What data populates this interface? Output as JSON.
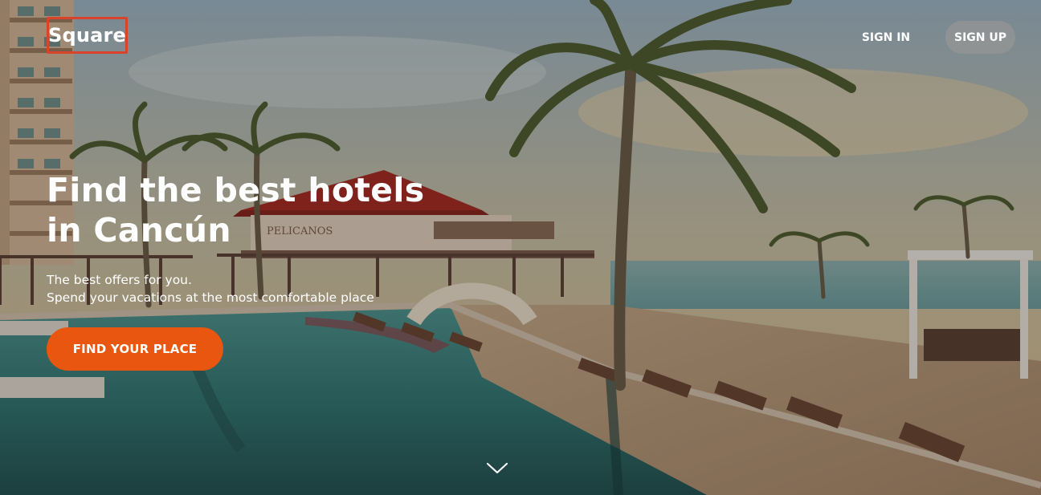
{
  "header": {
    "logo_text": "Square",
    "sign_in_label": "SIGN IN",
    "sign_up_label": "SIGN UP"
  },
  "hero": {
    "headline_lines": [
      "Find the best hotels",
      "in Cancún"
    ],
    "sub_lines": [
      "The best offers for you.",
      "Spend your vacations at the most comfortable place"
    ],
    "cta_label": "FIND YOUR PLACE",
    "sign_text": "PELICANOS",
    "scroll_icon": "chevron-down-icon"
  },
  "colors": {
    "accent": "#e8560f",
    "logo_border": "#d9432c",
    "signup_bg": "#969696",
    "text": "#ffffff"
  }
}
